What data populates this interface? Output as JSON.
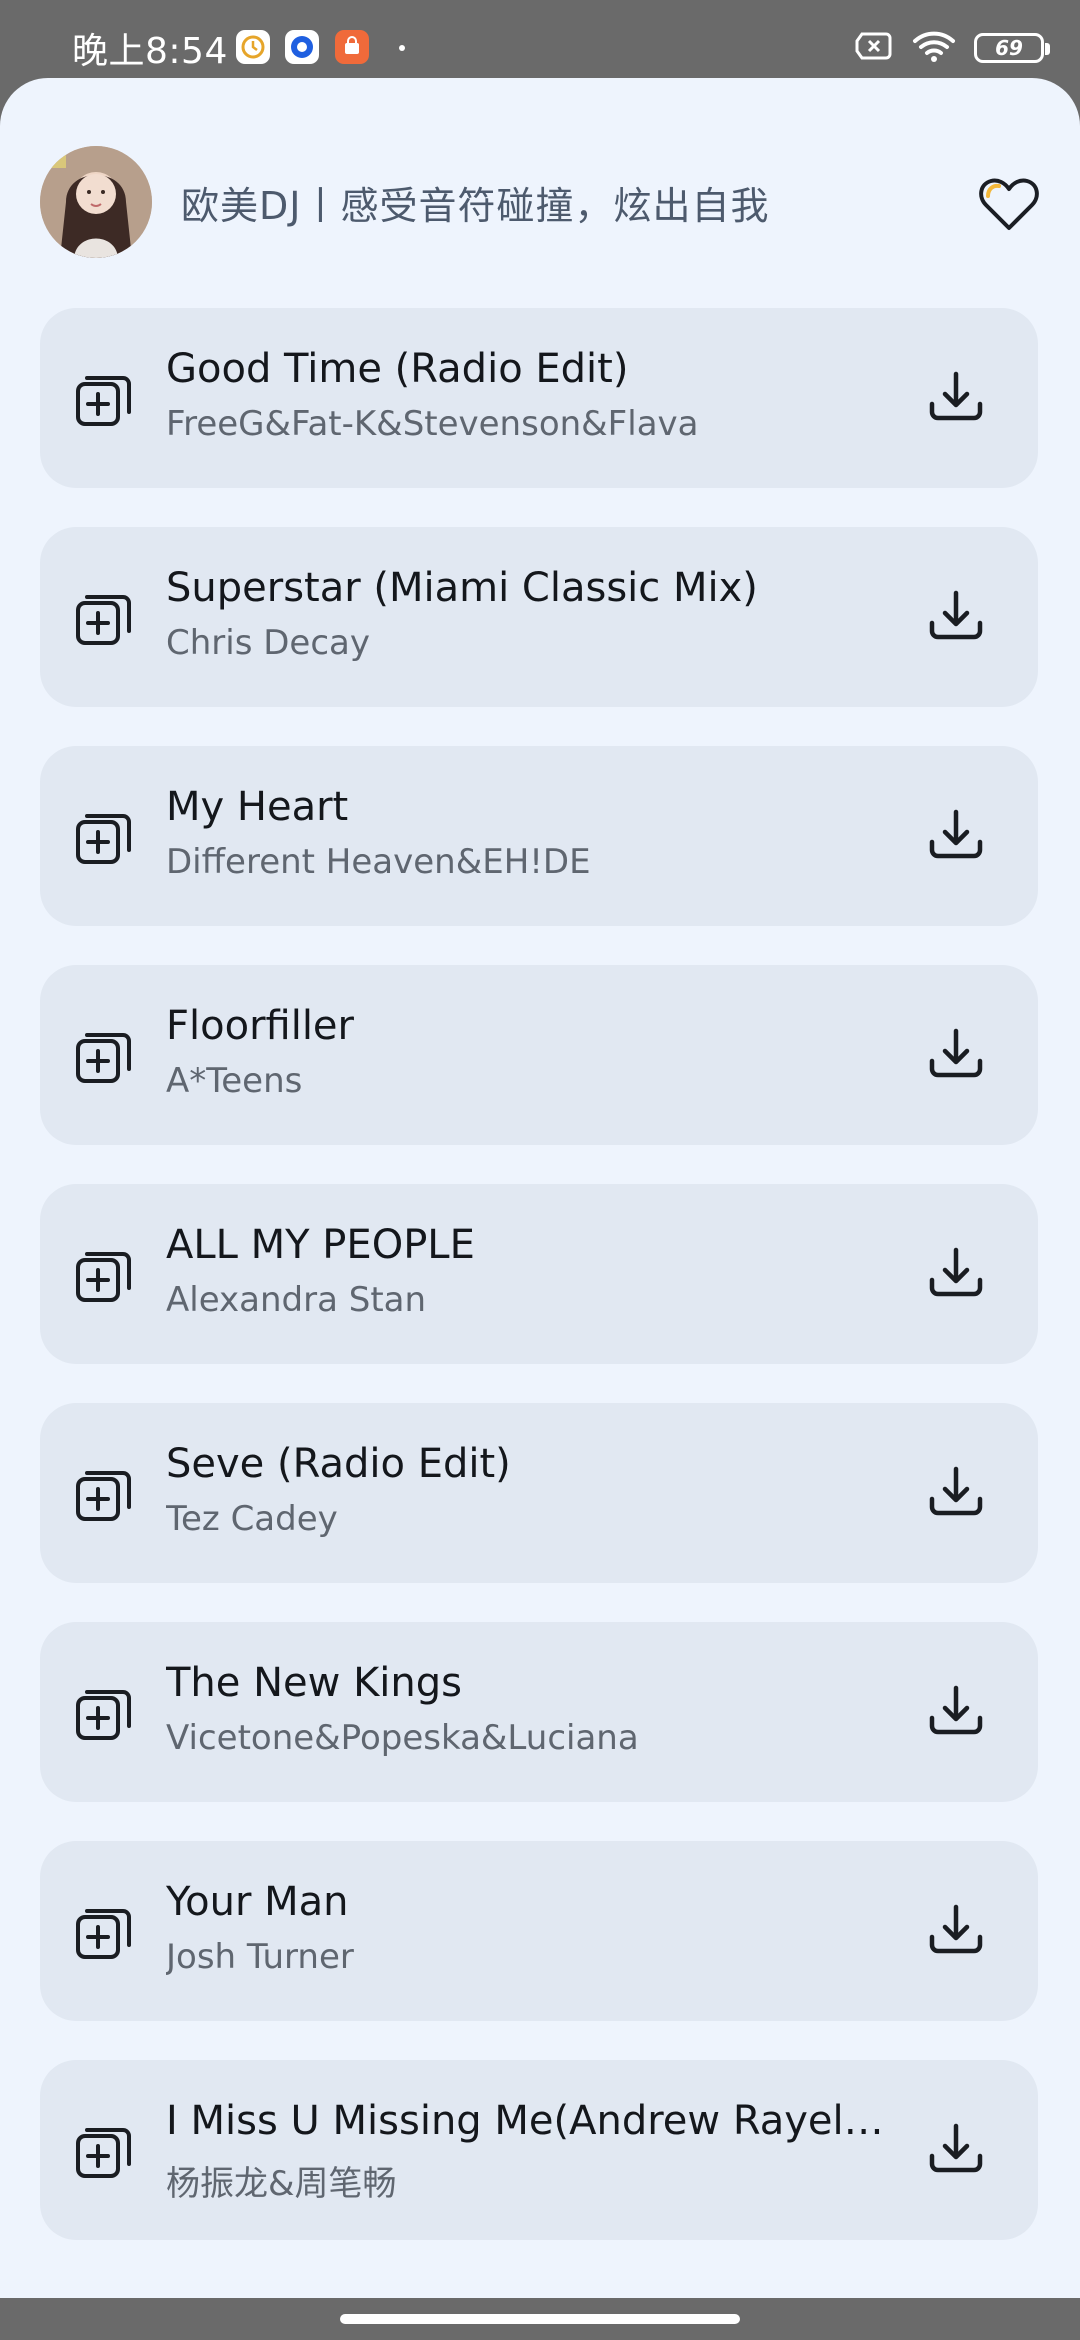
{
  "status_bar": {
    "time": "晚上8:54",
    "battery": "69",
    "icons": [
      "clock-app-icon",
      "browser-app-icon",
      "shop-app-icon",
      "dot-indicator",
      "sim-off-icon",
      "wifi-icon",
      "battery-icon"
    ]
  },
  "header": {
    "title": "欧美DJ丨感受音符碰撞，炫出自我",
    "avatar_icon": "avatar",
    "favorite_icon": "heart-icon"
  },
  "songs": [
    {
      "title": "Good Time (Radio Edit)",
      "artist": "FreeG&Fat-K&Stevenson&Flava"
    },
    {
      "title": "Superstar (Miami Classic Mix)",
      "artist": "Chris Decay"
    },
    {
      "title": "My Heart",
      "artist": "Different Heaven&EH!DE"
    },
    {
      "title": "Floorfiller",
      "artist": "A*Teens"
    },
    {
      "title": "ALL MY PEOPLE",
      "artist": "Alexandra Stan"
    },
    {
      "title": "Seve (Radio Edit)",
      "artist": "Tez Cadey"
    },
    {
      "title": "The New Kings",
      "artist": "Vicetone&Popeska&Luciana"
    },
    {
      "title": "Your Man",
      "artist": "Josh Turner"
    },
    {
      "title": "I Miss U Missing Me(Andrew Rayel…",
      "artist": "杨振龙&周笔畅"
    }
  ],
  "colors": {
    "background": "#eef4fd",
    "card": "#e1e8f2",
    "title_text": "#14171c",
    "artist_text": "#5f6670",
    "header_text": "#4d5a6d",
    "status_bar": "#6a6a6a"
  }
}
